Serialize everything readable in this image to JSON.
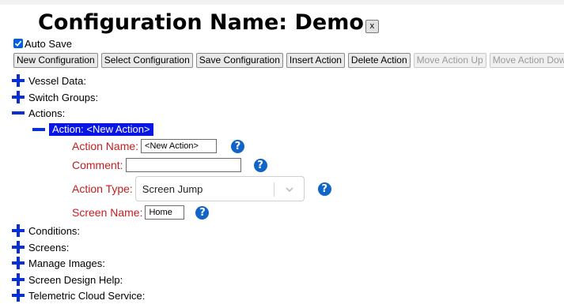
{
  "header": {
    "title": "Configuration Name: Demo",
    "close_label": "x"
  },
  "autosave": {
    "label": "Auto Save",
    "checked": true
  },
  "toolbar": [
    {
      "label": "New Configuration",
      "disabled": false
    },
    {
      "label": "Select Configuration",
      "disabled": false
    },
    {
      "label": "Save Configuration",
      "disabled": false
    },
    {
      "label": "Insert Action",
      "disabled": false
    },
    {
      "label": "Delete Action",
      "disabled": false
    },
    {
      "label": "Move Action Up",
      "disabled": true
    },
    {
      "label": "Move Action Down",
      "disabled": true
    }
  ],
  "tree": {
    "vessel_data": "Vessel Data:",
    "switch_groups": "Switch Groups:",
    "actions": "Actions:",
    "action_item": "Action: <New Action>",
    "conditions": "Conditions:",
    "screens": "Screens:",
    "manage_images": "Manage Images:",
    "screen_design_help": "Screen Design Help:",
    "telemetric_cloud": "Telemetric Cloud Service:"
  },
  "action_form": {
    "name_label": "Action Name:",
    "name_value": "<New Action>",
    "comment_label": "Comment:",
    "comment_value": "",
    "type_label": "Action Type:",
    "type_value": "Screen Jump",
    "screen_label": "Screen Name:",
    "screen_value": "Home"
  },
  "icons": {
    "help": "?",
    "expand": "plus-icon",
    "collapse": "minus-icon"
  },
  "colors": {
    "tree_icon": "#0a2fd6",
    "selected_bg": "#0a16e6",
    "field_label": "#c31e1e",
    "help_icon": "#1165c8"
  }
}
